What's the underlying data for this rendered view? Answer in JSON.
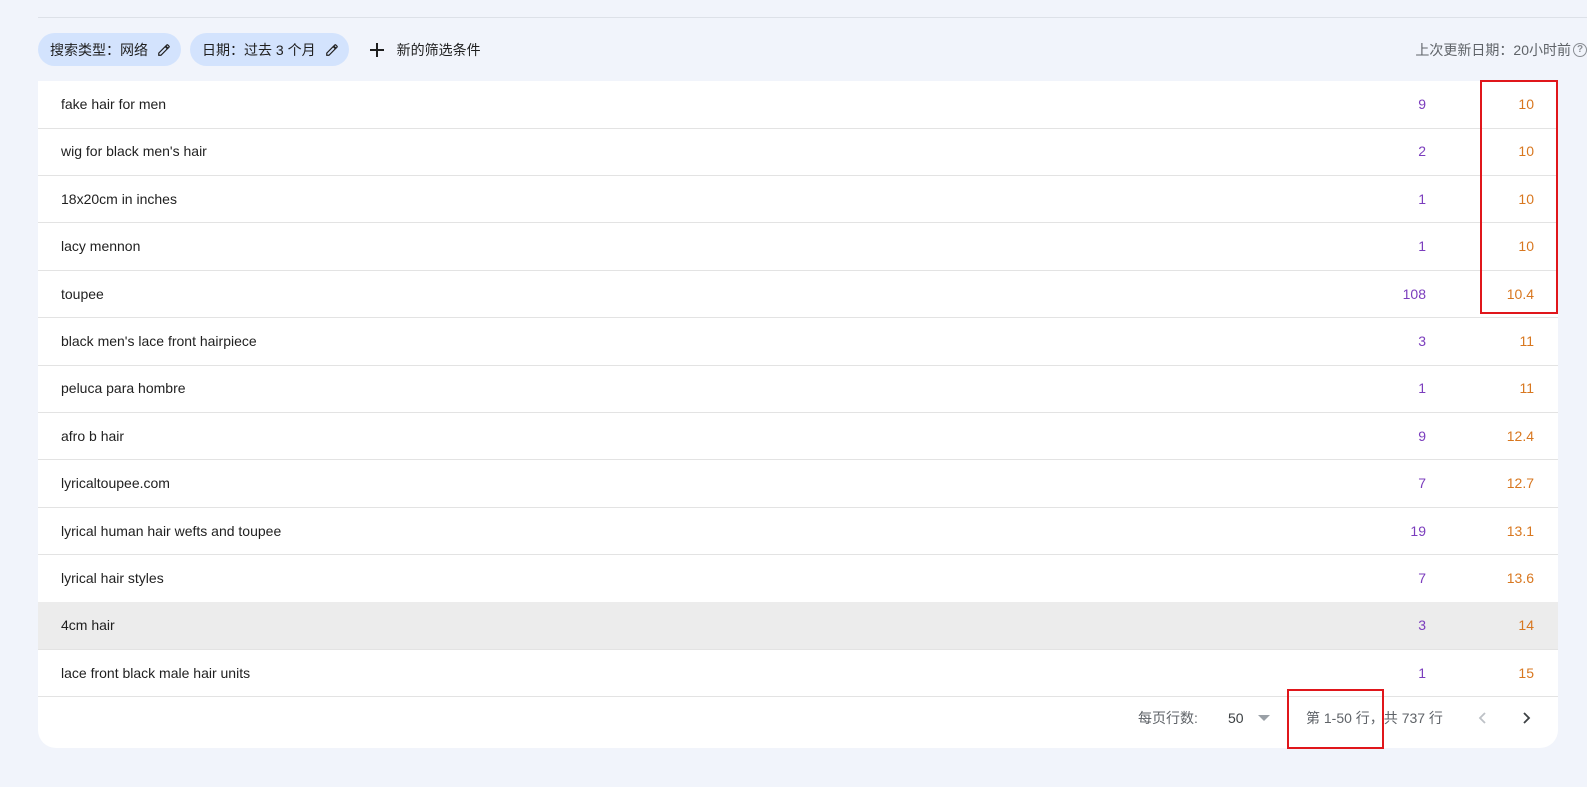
{
  "filters": {
    "search_type_chip": "搜索类型：网络",
    "date_chip": "日期：过去 3 个月",
    "add_filter_label": "新的筛选条件",
    "last_updated": "上次更新日期：20小时前"
  },
  "table": {
    "rows": [
      {
        "query": "fake hair for men",
        "clicks": "9",
        "position": "10"
      },
      {
        "query": "wig for black men's hair",
        "clicks": "2",
        "position": "10"
      },
      {
        "query": "18x20cm in inches",
        "clicks": "1",
        "position": "10"
      },
      {
        "query": "lacy mennon",
        "clicks": "1",
        "position": "10"
      },
      {
        "query": "toupee",
        "clicks": "108",
        "position": "10.4"
      },
      {
        "query": "black men's lace front hairpiece",
        "clicks": "3",
        "position": "11"
      },
      {
        "query": "peluca para hombre",
        "clicks": "1",
        "position": "11"
      },
      {
        "query": "afro b hair",
        "clicks": "9",
        "position": "12.4"
      },
      {
        "query": "lyricaltoupee.com",
        "clicks": "7",
        "position": "12.7"
      },
      {
        "query": "lyrical human hair wefts and toupee",
        "clicks": "19",
        "position": "13.1"
      },
      {
        "query": "lyrical hair styles",
        "clicks": "7",
        "position": "13.6"
      },
      {
        "query": "4cm hair",
        "clicks": "3",
        "position": "14"
      },
      {
        "query": "lace front black male hair units",
        "clicks": "1",
        "position": "15"
      }
    ]
  },
  "pagination": {
    "rows_per_page_label": "每页行数:",
    "rows_per_page_value": "50",
    "range_text": "第 1-50 行，共 737 行"
  },
  "colors": {
    "clicks": "#7b3dbd",
    "position": "#d8771f",
    "chip_bg": "#d3e3fd",
    "annotation": "#e0161b"
  },
  "icons": {
    "edit": "pencil-icon",
    "add": "plus-icon",
    "help": "help-circle-icon",
    "prev": "chevron-left-icon",
    "next": "chevron-right-icon",
    "dropdown": "caret-down-icon"
  }
}
